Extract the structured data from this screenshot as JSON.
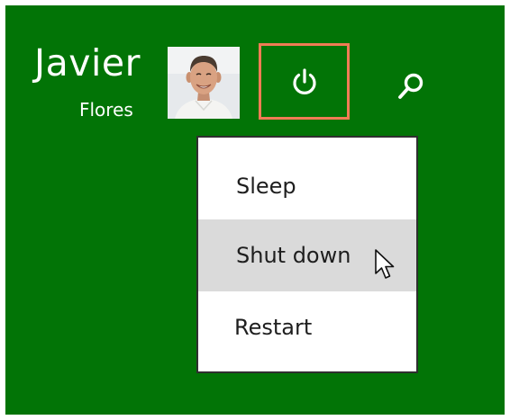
{
  "user": {
    "first_name": "Javier",
    "last_name": "Flores",
    "avatar_icon": "user-avatar-photo"
  },
  "top_bar": {
    "power_icon": "power-icon",
    "search_icon": "search-icon",
    "highlight_color": "#f07c55"
  },
  "power_menu": {
    "items": [
      {
        "label": "Sleep"
      },
      {
        "label": "Shut down",
        "hovered": true
      },
      {
        "label": "Restart"
      }
    ],
    "hover_color": "#dadada"
  },
  "colors": {
    "start_background": "#027406",
    "text_on_background": "#ffffff"
  },
  "pointer_icon": "mouse-cursor-icon"
}
